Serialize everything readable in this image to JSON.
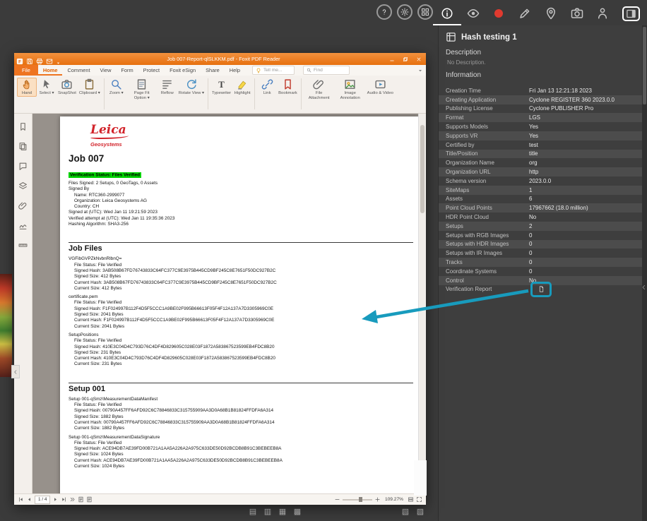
{
  "colors": {
    "orange": "#ee7420",
    "teal": "#189bbd",
    "green": "#00d400",
    "leica-red": "#d2232a"
  },
  "top_bar": {
    "window_buttons": [
      {
        "name": "help-button",
        "icon": "help-icon"
      },
      {
        "name": "settings-button",
        "icon": "gear-icon"
      },
      {
        "name": "apps-button",
        "icon": "grid-icon"
      }
    ],
    "panel_toolbar": [
      {
        "name": "info-tab",
        "icon": "info-icon",
        "active": true
      },
      {
        "name": "visibility-tab",
        "icon": "eye-icon"
      },
      {
        "name": "record-button",
        "icon": "record-icon"
      },
      {
        "name": "markup-tab",
        "icon": "pencil-icon"
      },
      {
        "name": "geotag-tab",
        "icon": "pin-icon"
      },
      {
        "name": "snapshot-tab",
        "icon": "camera-icon"
      },
      {
        "name": "presenter-tab",
        "icon": "person-icon"
      },
      {
        "name": "panel-toggle",
        "icon": "panel-icon",
        "boxed": true
      }
    ]
  },
  "side_panel": {
    "title": "Hash testing 1",
    "description_label": "Description",
    "description_value": "No Description.",
    "information_label": "Information",
    "rows": [
      {
        "key": "Creation Time",
        "value": "Fri Jan 13 12:21:18 2023"
      },
      {
        "key": "Creating Application",
        "value": "Cyclone REGISTER 360 2023.0.0"
      },
      {
        "key": "Publishing License",
        "value": "Cyclone PUBLISHER Pro"
      },
      {
        "key": "Format",
        "value": "LGS"
      },
      {
        "key": "Supports Models",
        "value": "Yes"
      },
      {
        "key": "Supports VR",
        "value": "Yes"
      },
      {
        "key": "Certified by",
        "value": "test"
      },
      {
        "key": "Title/Position",
        "value": "title"
      },
      {
        "key": "Organization Name",
        "value": "org"
      },
      {
        "key": "Organization URL",
        "value": "http"
      },
      {
        "key": "Schema version",
        "value": "2023.0.0"
      },
      {
        "key": "SiteMaps",
        "value": "1"
      },
      {
        "key": "Assets",
        "value": "6"
      },
      {
        "key": "Point Cloud Points",
        "value": "17967662 (18.0 million)"
      },
      {
        "key": "HDR Point Cloud",
        "value": "No"
      },
      {
        "key": "Setups",
        "value": "2"
      },
      {
        "key": "Setups with RGB Images",
        "value": "0"
      },
      {
        "key": "Setups with HDR Images",
        "value": "0"
      },
      {
        "key": "Setups with IR Images",
        "value": "0"
      },
      {
        "key": "Tracks",
        "value": "0"
      },
      {
        "key": "Coordinate Systems",
        "value": "0"
      },
      {
        "key": "Control",
        "value": "No"
      },
      {
        "key": "Verification Report",
        "icon": "report-doc-icon"
      }
    ]
  },
  "foxit": {
    "window_title": "Job 007-Report-qlSLKKM.pdf - Foxit PDF Reader",
    "menu_tabs": [
      {
        "label": "File",
        "file": true
      },
      {
        "label": "Home",
        "active": true
      },
      {
        "label": "Comment"
      },
      {
        "label": "View"
      },
      {
        "label": "Form"
      },
      {
        "label": "Protect"
      },
      {
        "label": "Foxit eSign"
      },
      {
        "label": "Share"
      },
      {
        "label": "Help"
      }
    ],
    "tell_me": "Tell me...",
    "find": "Find",
    "tools": [
      {
        "label": "Hand",
        "icon": "hand-icon",
        "active": true
      },
      {
        "label": "Select",
        "icon": "select-icon",
        "dropdown": true
      },
      {
        "label": "SnapShot",
        "icon": "snapshot-icon"
      },
      {
        "label": "Clipboard",
        "icon": "clipboard-icon",
        "dropdown": true
      },
      {
        "label": "Zoom",
        "icon": "zoom-icon",
        "dropdown": true,
        "group": true
      },
      {
        "label": "Page Fit Option",
        "icon": "pagefit-icon",
        "dropdown": true
      },
      {
        "label": "Reflow",
        "icon": "reflow-icon"
      },
      {
        "label": "Rotate View",
        "icon": "rotate-icon",
        "dropdown": true
      },
      {
        "label": "Typewriter",
        "icon": "typewriter-icon",
        "group": true
      },
      {
        "label": "Highlight",
        "icon": "highlight-icon"
      },
      {
        "label": "Link",
        "icon": "link-icon",
        "group": true
      },
      {
        "label": "Bookmark",
        "icon": "bookmark-icon"
      },
      {
        "label": "File Attachment",
        "icon": "attach-icon",
        "group": true
      },
      {
        "label": "Image Annotation",
        "icon": "image-icon"
      },
      {
        "label": "Audio & Video",
        "icon": "av-icon"
      }
    ],
    "nav_icons": [
      "nav-bookmarks-icon",
      "nav-pages-icon",
      "nav-comments-icon",
      "nav-layers-icon",
      "nav-attachments-icon",
      "nav-signatures-icon",
      "nav-measure-icon"
    ],
    "status": {
      "page_current": "1 / 4",
      "zoom": "109.27%"
    }
  },
  "pdf": {
    "logo_name": "Leica",
    "logo_sub": "Geosystems",
    "sections": [
      {
        "heading": "Job 007",
        "highlight": "Verification Status: Files Verified",
        "lines": [
          {
            "t": "Files Signed: 2 Setups, 0 GeoTags, 0 Assets"
          },
          {
            "t": "Signed By"
          },
          {
            "t": "Name: RTC360-2999077",
            "i": 1
          },
          {
            "t": "Organization: Leica Geosystems AG",
            "i": 1
          },
          {
            "t": "Country: CH",
            "i": 1
          },
          {
            "t": "Signed at (UTC): Wed Jan 11 19:21:59 2023"
          },
          {
            "t": "Verified attempt at (UTC): Wed Jan 11 19:35:36 2023"
          },
          {
            "t": "Hashing Algorithm: SHA3-256"
          }
        ]
      },
      {
        "heading": "Job Files",
        "rule": true,
        "files": [
          {
            "name": "VGFibGVPZkNvbnRlbnQ=",
            "details": [
              "File Status: File Verified",
              "Signed Hash: 3AB508B67FD76743833C64FC377C9E3975B445CD9BF245C8E7651F50DC927B2C",
              "Signed Size: 412 Bytes",
              "Current Hash: 3AB508B67FD76743833C64FC377C9E3975B445CD9BF245C8E7651F50DC927B2C",
              "Current Size: 412 Bytes"
            ]
          },
          {
            "name": "certificate.pem",
            "details": [
              "File Status: File Verified",
              "Signed Hash: F1F024997B112F4D5F5CCC1A9BE02F995B66613F05F4F12A137A7D3305969C0E",
              "Signed Size: 2041 Bytes",
              "Current Hash: F1F024997B112F4D5F5CCC1A9BE02F995B66613F05F4F12A137A7D3305969C0E",
              "Current Size: 2041 Bytes"
            ]
          },
          {
            "name": "SetupPositions",
            "details": [
              "File Status: File Verified",
              "Signed Hash: 410E3C04D4C793D76C4DF4D829605C028E03F1872A583867523599EB4FDC8B20",
              "Signed Size: 231 Bytes",
              "Current Hash: 410E3C04D4C793D76C4DF4D829605C028E03F1872A583867523599EB4FDC8B20",
              "Current Size: 231 Bytes"
            ]
          }
        ]
      },
      {
        "heading": "Setup 001",
        "rule": true,
        "files": [
          {
            "name": "Setup 001-qSmz\\MeasurementDataManifest",
            "details": [
              "File Status: File Verified",
              "Signed Hash: 00790A457FF6AFD92C6C78846833C315755909AA3D0A68B1B81824FFDFA6A314",
              "Signed Size: 1882 Bytes",
              "Current Hash: 00790A457FF6AFD92C6C78846833C315755909AA3D0A68B1B81824FFDFA6A314",
              "Current Size: 1882 Bytes"
            ]
          },
          {
            "name": "Setup 001-qSmz\\MeasurementDataSignature",
            "details": [
              "File Status: File Verified",
              "Signed Hash: ACE94DB7AE39FD00B721A1AA5A226A2A975C633DE50D92BCDB8B91C3BEBEEB8A",
              "Signed Size: 1024 Bytes",
              "Current Hash: ACE94DB7AE39FD00B721A1AA5A226A2A975C633DE50D92BCDB8B91C3BEBEEB8A",
              "Current Size: 1024 Bytes"
            ]
          }
        ]
      }
    ]
  },
  "desktop": {
    "bottom_icons": [
      "layout-1-icon",
      "layout-2-icon",
      "layout-3-icon",
      "layout-4-icon"
    ],
    "bottom_icons_2": [
      "layout-5-icon",
      "layout-6-icon"
    ]
  }
}
